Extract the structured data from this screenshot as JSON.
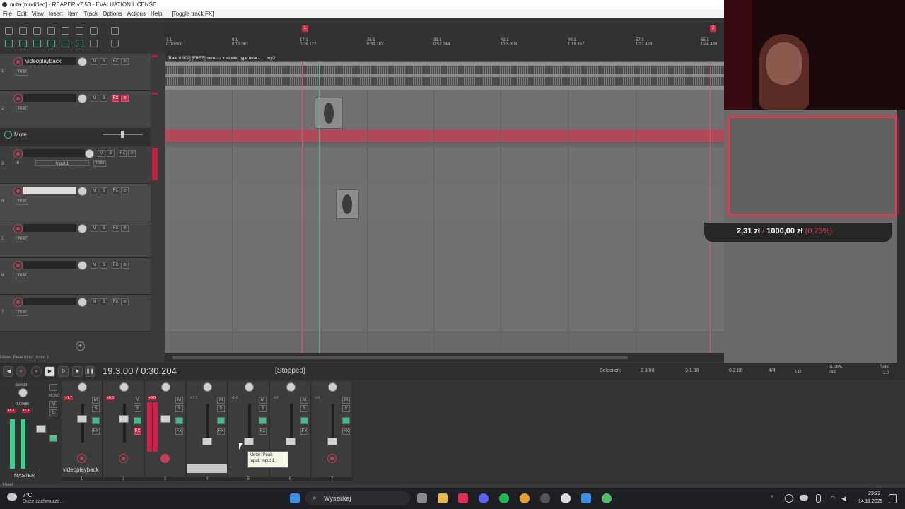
{
  "window": {
    "title": "nuta [modified] - REAPER v7.53 - EVALUATION LICENSE"
  },
  "menu": [
    "File",
    "Edit",
    "View",
    "Insert",
    "Item",
    "Track",
    "Options",
    "Actions",
    "Help",
    "[Toggle track FX]"
  ],
  "ruler": {
    "ticks": [
      {
        "bar": "1.1",
        "time": "0:00.000"
      },
      {
        "bar": "9.1",
        "time": "0:13.061"
      },
      {
        "bar": "17.1",
        "time": "0:26.122"
      },
      {
        "bar": "25.1",
        "time": "0:39.183"
      },
      {
        "bar": "33.1",
        "time": "0:52.244"
      },
      {
        "bar": "41.1",
        "time": "1:05.306"
      },
      {
        "bar": "49.1",
        "time": "1:18.367"
      },
      {
        "bar": "57.1",
        "time": "1:31.428"
      },
      {
        "bar": "65.1",
        "time": "1:44.489"
      }
    ],
    "markers": [
      "1",
      "2"
    ]
  },
  "tracks": [
    {
      "num": "1",
      "name": "videoplayback",
      "trim": "TRIM"
    },
    {
      "num": "2",
      "name": "",
      "trim": "TRIM"
    },
    {
      "num": "3",
      "name": "",
      "input": "In",
      "input_name": "Input 1",
      "trim": "TRIM"
    },
    {
      "num": "4",
      "name": "",
      "trim": "TRIM"
    },
    {
      "num": "5",
      "name": "",
      "trim": "TRIM"
    },
    {
      "num": "6",
      "name": "",
      "trim": "TRIM"
    },
    {
      "num": "7",
      "name": "",
      "trim": "TRIM"
    }
  ],
  "mute_lane": {
    "label": "Mute"
  },
  "item_label": "[Rate:0.902] [FREE] nemzzz x sixwitd type beat - ... .mp3",
  "mini_labels": {
    "m": "M",
    "s": "S",
    "fx": "FX",
    "phase": "⊘"
  },
  "meter_hint": "Meter: Peak Input: Input 1",
  "transport": {
    "time": "19.3.00 / 0:30.204",
    "status": "[Stopped]",
    "selection_label": "Selection:",
    "sel_start": "2.3.00",
    "sel_end": "3.1.00",
    "sel_len": "0.2.00",
    "timesig": "4/4",
    "bpm": "147",
    "global": "GLOBAL",
    "global_state": "OFF",
    "rate_label": "Rate:",
    "rate": "1.0"
  },
  "mixer": {
    "master_label": "MASTER",
    "master_pan": "center",
    "master_vol": "0.00dB",
    "master_peak_l": "+5.1",
    "master_peak_r": "+5.1",
    "strip1_name": "videoplayback",
    "strips": [
      {
        "num": "1",
        "peak": "+1.7"
      },
      {
        "num": "2",
        "peak": "+0.0"
      },
      {
        "num": "3",
        "peak": "+0.0"
      },
      {
        "num": "4",
        "peak": "-47.1"
      },
      {
        "num": "5",
        "peak": "+0.0"
      },
      {
        "num": "6",
        "peak": "-inf"
      },
      {
        "num": "7",
        "peak": "-inf"
      }
    ],
    "tooltip_line1": "Meter: Peak",
    "tooltip_line2": "Input: Input 1",
    "tab": "Mixer"
  },
  "donation": {
    "current": "2,31 zł",
    "sep": "/",
    "goal": "1000,00 zł",
    "percent": "(0,23%)"
  },
  "taskbar": {
    "weather_temp": "7°C",
    "weather_desc": "Duże zachmurze...",
    "search_placeholder": "Wyszukaj",
    "clock_time": "23:22",
    "clock_date": "14.11.2025"
  },
  "colors": {
    "accent": "#d0304a",
    "green": "#3cc08a",
    "bg": "#3a3a3a"
  }
}
